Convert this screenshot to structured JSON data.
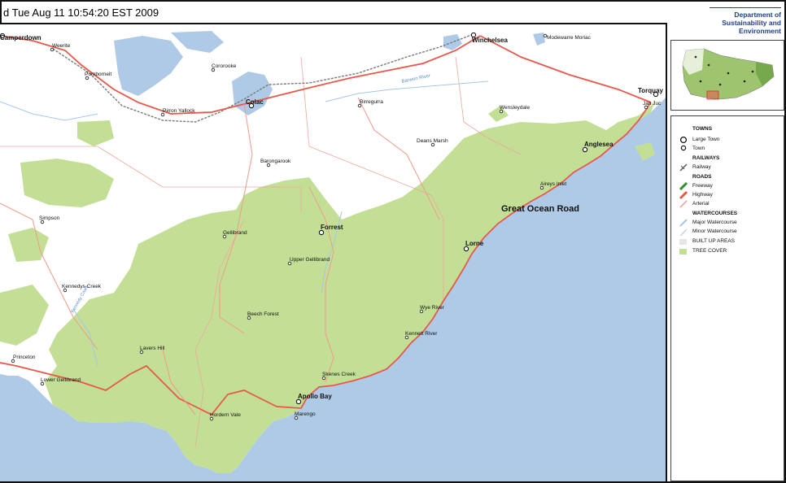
{
  "header": {
    "timestamp": "d Tue Aug 11 10:54:20 EST 2009"
  },
  "logo": {
    "line1": "Department of",
    "line2": "Sustainability and",
    "line3": "Environment"
  },
  "colors": {
    "ocean": "#aecae6",
    "tree_cover": "#c2df95",
    "highway": "#e8584a",
    "arterial": "#f29a8c",
    "watercourse": "#a9c6ea",
    "railway": "#7a7a7a",
    "built_up": "#e6e6e6"
  },
  "map": {
    "towns": [
      {
        "id": "camperdown",
        "name": "Camperdown",
        "size": "large"
      },
      {
        "id": "weerite",
        "name": "Weerite",
        "size": "small"
      },
      {
        "id": "winchelsea",
        "name": "Winchelsea",
        "size": "large"
      },
      {
        "id": "modewarre",
        "name": "Modewarre Moriac",
        "size": "small"
      },
      {
        "id": "pomborneit",
        "name": "Pomborneit",
        "size": "small"
      },
      {
        "id": "cororooke",
        "name": "Cororooke",
        "size": "small"
      },
      {
        "id": "torquay",
        "name": "Torquay",
        "size": "large"
      },
      {
        "id": "jan-juc",
        "name": "Jan Juc",
        "size": "small"
      },
      {
        "id": "colac",
        "name": "Colac",
        "size": "large"
      },
      {
        "id": "pirron-yallock",
        "name": "Pirron Yallock",
        "size": "small"
      },
      {
        "id": "birregurra",
        "name": "Birregurra",
        "size": "small"
      },
      {
        "id": "wensleydale",
        "name": "Wensleydale",
        "size": "small"
      },
      {
        "id": "deans-marsh",
        "name": "Deans Marsh",
        "size": "small"
      },
      {
        "id": "anglesea",
        "name": "Anglesea",
        "size": "large"
      },
      {
        "id": "barongarook",
        "name": "Barongarook",
        "size": "small"
      },
      {
        "id": "aireys-inlet",
        "name": "Aireys Inlet",
        "size": "small"
      },
      {
        "id": "simpson",
        "name": "Simpson",
        "size": "small"
      },
      {
        "id": "forrest",
        "name": "Forrest",
        "size": "large"
      },
      {
        "id": "gellibrand",
        "name": "Gellibrand",
        "size": "small"
      },
      {
        "id": "lorne",
        "name": "Lorne",
        "size": "large"
      },
      {
        "id": "upper-gellibrand",
        "name": "Upper Gellibrand",
        "size": "small"
      },
      {
        "id": "kennedys-creek",
        "name": "Kennedys Creek",
        "size": "small"
      },
      {
        "id": "beech-forest",
        "name": "Beech Forest",
        "size": "small"
      },
      {
        "id": "wye-river",
        "name": "Wye River",
        "size": "small"
      },
      {
        "id": "kennett-river",
        "name": "Kennett River",
        "size": "small"
      },
      {
        "id": "lavers-hill",
        "name": "Lavers Hill",
        "size": "small"
      },
      {
        "id": "princeton",
        "name": "Princeton",
        "size": "small"
      },
      {
        "id": "lower-gellibrand",
        "name": "Lower Gellibrand",
        "size": "small"
      },
      {
        "id": "skenes-creek",
        "name": "Skenes Creek",
        "size": "small"
      },
      {
        "id": "apollo-bay",
        "name": "Apollo Bay",
        "size": "large"
      },
      {
        "id": "hordern-vale",
        "name": "Hordern Vale",
        "size": "small"
      },
      {
        "id": "marengo",
        "name": "Marengo",
        "size": "small"
      }
    ],
    "feature_labels": {
      "great_ocean_road": "Great Ocean Road",
      "barwon_river": "Barwon River",
      "fruit_creek": "Kennedy Creek"
    }
  },
  "legend": {
    "towns_heading": "TOWNS",
    "large_town": "Large Town",
    "town": "Town",
    "railways_heading": "RAILWAYS",
    "railway": "Railway",
    "roads_heading": "ROADS",
    "freeway": "Freeway",
    "highway": "Highway",
    "arterial": "Arterial",
    "watercourses_heading": "WATERCOURSES",
    "major_watercourse": "Major Watercourse",
    "minor_watercourse": "Minor Watercourse",
    "built_up": "BUILT UP AREAS",
    "tree_cover": "TREE COVER"
  }
}
